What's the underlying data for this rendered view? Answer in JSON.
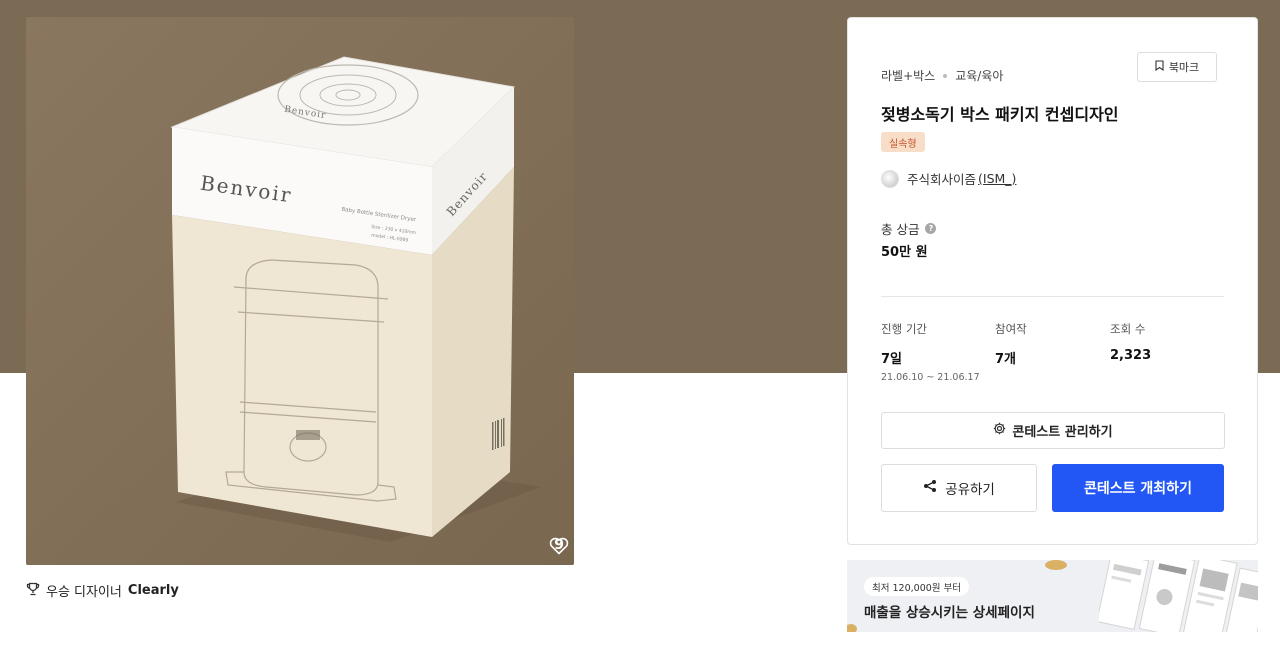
{
  "product": {
    "like_count": "9",
    "box_brand": "Benvoir",
    "box_subtitle": "Baby Bottle Sterilizer Dryer",
    "box_size": "Size : 230 x 410mm",
    "box_model": "model : HL-0989"
  },
  "winner": {
    "label": "우승 디자이너",
    "name": "Clearly"
  },
  "info": {
    "category_main": "라벨+박스",
    "category_sub": "교육/육아",
    "bookmark_label": "북마크",
    "title": "젖병소독기 박스 패키지 컨셉디자인",
    "badge": "실속형",
    "host_name": "주식회사이즘",
    "host_handle": "(ISM_)",
    "prize_label": "총 상금",
    "prize_value": "50만 원",
    "stats": [
      {
        "label": "진행 기간",
        "value": "7일",
        "sub": "21.06.10 ~ 21.06.17"
      },
      {
        "label": "참여작",
        "value": "7개",
        "sub": ""
      },
      {
        "label": "조회 수",
        "value": "2,323",
        "sub": ""
      }
    ],
    "manage_button": "콘테스트 관리하기",
    "share_button": "공유하기",
    "host_button": "콘테스트 개최하기"
  },
  "banner": {
    "pill": "최저 120,000원 부터",
    "headline": "매출을 상승시키는 상세페이지"
  },
  "colors": {
    "hero_bg": "#7b6a54",
    "primary_button": "#2257f5",
    "badge_bg": "#f8ddc8",
    "badge_text": "#c5552b"
  },
  "icons": {
    "heart": "heart-icon",
    "trophy": "trophy-icon",
    "bookmark": "bookmark-icon",
    "gear": "gear-icon",
    "share": "share-icon",
    "help": "help-icon"
  }
}
